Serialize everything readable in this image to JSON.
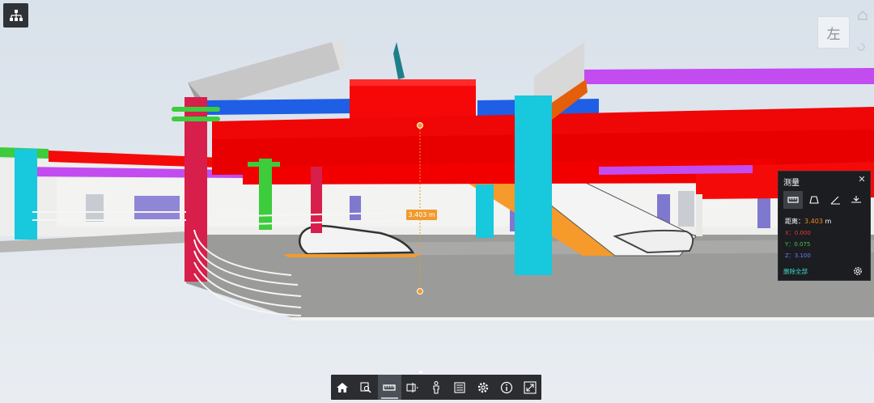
{
  "viewcube": {
    "face_label": "左"
  },
  "measure_panel": {
    "title": "测量",
    "close_glyph": "✕",
    "modes": [
      {
        "name": "distance-mode",
        "active": true
      },
      {
        "name": "area-mode",
        "active": false
      },
      {
        "name": "angle-mode",
        "active": false
      },
      {
        "name": "elevation-mode",
        "active": false
      }
    ],
    "distance_label": "距离：",
    "distance_value": "3.403",
    "distance_unit": "m",
    "x_label": "X：",
    "x_value": "0.000",
    "y_label": "Y：",
    "y_value": "0.075",
    "z_label": "Z：",
    "z_value": "3.100",
    "clear_all": "删除全部"
  },
  "measurement_label": "3.403 m",
  "toolbar": {
    "tools": [
      {
        "name": "home-view",
        "icon": "home-icon"
      },
      {
        "name": "zoom-region",
        "icon": "zoom-region-icon"
      },
      {
        "name": "measure",
        "icon": "ruler-icon",
        "active": true
      },
      {
        "name": "section",
        "icon": "section-box-icon"
      },
      {
        "name": "walk",
        "icon": "person-icon"
      },
      {
        "name": "properties-list",
        "icon": "list-icon"
      },
      {
        "name": "settings",
        "icon": "gear-icon"
      },
      {
        "name": "info",
        "icon": "info-icon"
      },
      {
        "name": "fullscreen",
        "icon": "fullscreen-icon"
      }
    ]
  },
  "colors": {
    "duct_red": "#f50a0a",
    "pipe_blue": "#2060e0",
    "column_cyan": "#18c8dc",
    "column_crimson": "#d81e4a",
    "escalator_orange": "#f59a2b",
    "purple_pipe": "#c24cf0",
    "green_pipe": "#38d438",
    "accent_orange": "#f29a2e",
    "clear_teal": "#3dd6c8"
  }
}
